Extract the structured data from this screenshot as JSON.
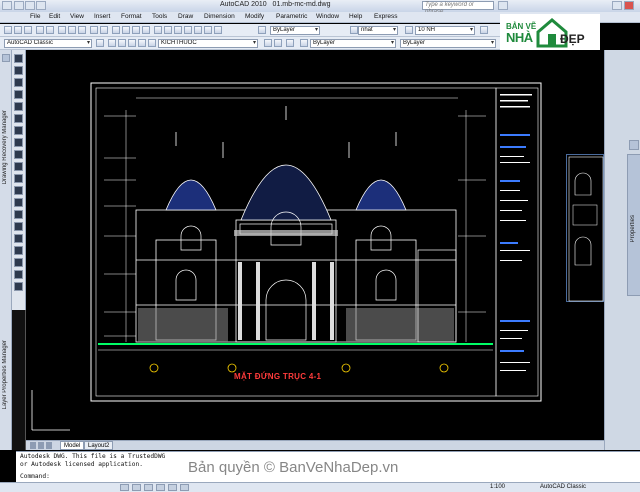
{
  "titlebar": {
    "app_title": "AutoCAD 2010",
    "file_name": "01.mb-mc-md.dwg",
    "search_placeholder": "Type a keyword or phrase"
  },
  "menu": [
    "File",
    "Edit",
    "View",
    "Insert",
    "Format",
    "Tools",
    "Draw",
    "Dimension",
    "Modify",
    "Parametric",
    "Window",
    "Help",
    "Express"
  ],
  "toolbar": {
    "workspace": "AutoCAD Classic",
    "layer": "KICHTHUOC",
    "color": "ByLayer",
    "style": "nhat",
    "dimstyle": "10 NH",
    "linetype": "ByLayer"
  },
  "logo": {
    "line1": "BẢN VẼ",
    "line2": "NHÀ",
    "line3": "ĐẸP"
  },
  "palettes": {
    "drawing_recovery": "Drawing Recovery Manager",
    "layer_properties": "Layer Properties Manager",
    "properties": "Properties"
  },
  "drawing": {
    "title": "MẶT ĐỨNG TRỤC 4-1"
  },
  "tabs": [
    "Model",
    "Layout2"
  ],
  "command": {
    "line1": "Autodesk DWG.  This file is a TrustedDWG",
    "line2": "or Autodesk licensed application.",
    "prompt": "Command:"
  },
  "status": {
    "scale": "1:100",
    "workspace": "AutoCAD Classic"
  },
  "watermark": "Bản quyền © BanVeNhaDep.vn"
}
